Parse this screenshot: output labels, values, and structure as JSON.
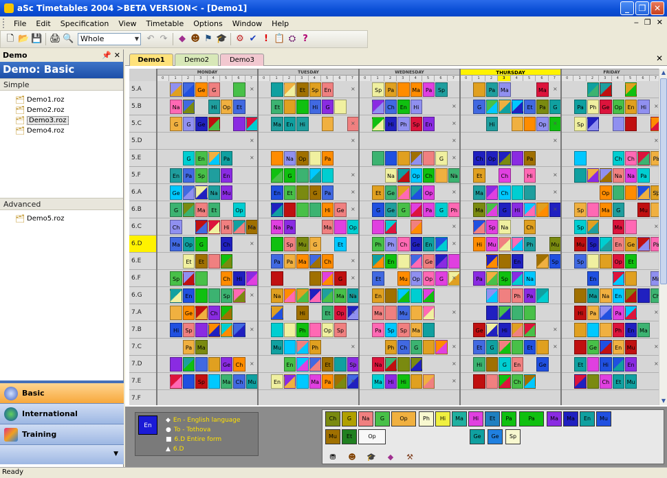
{
  "window": {
    "title": "aSc Timetables 2004  >BETA VERSION<  - [Demo1]"
  },
  "menu": [
    "File",
    "Edit",
    "Specification",
    "View",
    "Timetable",
    "Options",
    "Window",
    "Help"
  ],
  "toolbar": {
    "view_select": "Whole"
  },
  "left_panel": {
    "header": "Demo",
    "title": "Demo: Basic",
    "section_simple": "Simple",
    "simple_files": [
      "Demo1.roz",
      "Demo2.roz",
      "Demo3.roz",
      "Demo4.roz"
    ],
    "selected_file": "Demo3.roz",
    "section_advanced": "Advanced",
    "advanced_files": [
      "Demo5.roz"
    ],
    "nav": [
      "Basic",
      "International",
      "Training"
    ]
  },
  "tabs": [
    "Demo1",
    "Demo2",
    "Demo3"
  ],
  "timetable": {
    "days": [
      "MONDAY",
      "TUESDAY",
      "WEDNESDAY",
      "THURSDAY",
      "FRIDAY"
    ],
    "today_index": 3,
    "periods": [
      "0",
      "1",
      "2",
      "3",
      "4",
      "5",
      "6",
      "7"
    ],
    "classes": [
      "5.A",
      "5.B",
      "5.C",
      "5.D",
      "5.E",
      "5.F",
      "6.A",
      "6.B",
      "6.C",
      "6.D",
      "6.E",
      "6.F",
      "6.G",
      "7.A",
      "7.B",
      "7.C",
      "7.D",
      "7.E",
      "7.F"
    ],
    "active_class": "6.D"
  },
  "info": {
    "big_label": "En",
    "lines": [
      "En - English language",
      "To - Tothova",
      "6.D Entire form",
      "6.D"
    ]
  },
  "cards": [
    "Ch",
    "G",
    "Na",
    "G",
    "Op",
    "Ph",
    "Hi",
    "Ma",
    "Hi",
    "Et",
    "Pa",
    "Pa",
    "Ma",
    "Ma",
    "En",
    "Mu",
    "Mu",
    "Et",
    "Ge",
    "Op",
    "Ge",
    "Sp"
  ],
  "status": "Ready",
  "colors": {
    "Ma": "#1f9e9e",
    "En": "#7a8a10",
    "G": "#48c048",
    "Na": "#f08080",
    "Hi": "#e040e0",
    "Sp": "#9090f0",
    "Ge": "#10a0a0",
    "Ph": "#f0f0a0",
    "Mu": "#a07000",
    "Pa": "#10c010",
    "Ch": "#e0a020",
    "Ge2": "#2020c0",
    "Op": "#f0b040",
    "Et": "#2050e0",
    "Is": "#c01010"
  }
}
